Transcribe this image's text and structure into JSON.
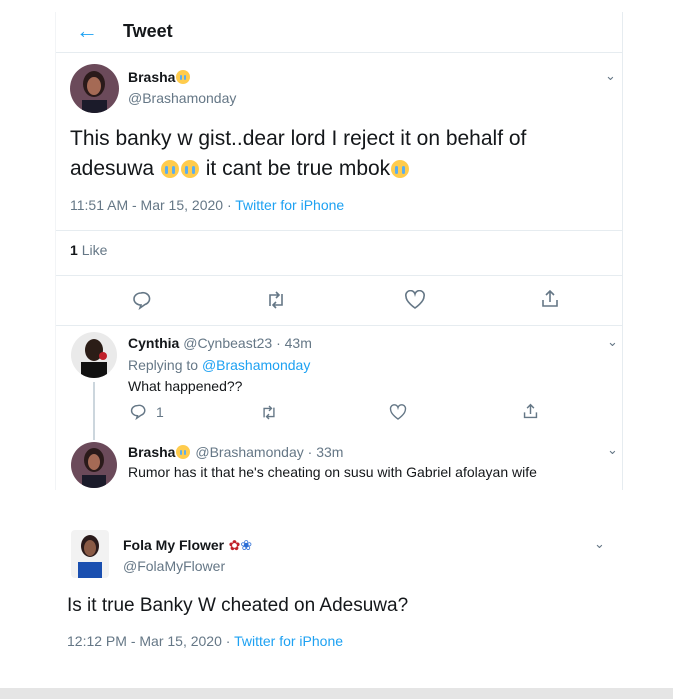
{
  "header": {
    "title": "Tweet"
  },
  "main_tweet": {
    "name": "Brasha",
    "handle": "@Brashamonday",
    "text_1": "This banky w gist..dear lord I reject it on behalf of",
    "text_2": "adesuwa",
    "text_3": "it cant be true mbok",
    "time": "11:51 AM - Mar 15, 2020",
    "source": "Twitter for iPhone",
    "likes_count": "1",
    "likes_label": "Like"
  },
  "reply_1": {
    "name": "Cynthia",
    "handle": "@Cynbeast23",
    "time": "43m",
    "replying_label": "Replying to",
    "replying_to": "@Brashamonday",
    "text": "What happened??",
    "reply_count": "1"
  },
  "reply_2": {
    "name": "Brasha",
    "handle": "@Brashamonday",
    "time": "33m",
    "text": "Rumor has it that he's cheating on susu with Gabriel afolayan wife"
  },
  "tweet_2": {
    "name": "Fola My Flower",
    "handle": "@FolaMyFlower",
    "text": "Is it true Banky W cheated on Adesuwa?",
    "time": "12:12 PM - Mar 15, 2020",
    "source": "Twitter for iPhone"
  },
  "icons": [
    "back-arrow-icon",
    "chevron-down-icon",
    "reply-icon",
    "retweet-icon",
    "like-icon",
    "share-icon",
    "rose-icon",
    "butterfly-icon",
    "crying-face-icon"
  ],
  "colors": {
    "accent": "#1da1f2",
    "muted": "#657786",
    "text": "#14171a",
    "border": "#e6ecf0"
  }
}
